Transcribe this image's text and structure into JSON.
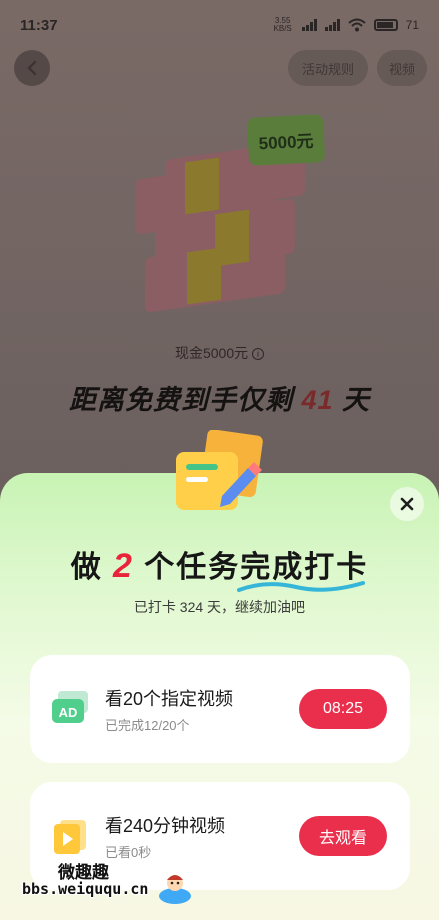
{
  "status_bar": {
    "time": "11:37",
    "net_speed": "3.55\nKB/S",
    "battery_percent": "71"
  },
  "header": {
    "back_icon": "chevron-left-icon",
    "pill_rules": "活动规则",
    "pill_video": "视频"
  },
  "reward": {
    "price_tag": "5000元",
    "cash_label": "现金5000元",
    "countdown_prefix": "距离免费到手仅剩",
    "countdown_days": "41",
    "countdown_suffix": "天"
  },
  "sheet": {
    "title_prefix": "做",
    "title_count": "2",
    "title_middle": "个任务",
    "title_emph": "完成打卡",
    "subtitle": "已打卡 324 天，继续加油吧",
    "close_icon": "close-icon"
  },
  "tasks": [
    {
      "icon": "ad-icon",
      "icon_text": "AD",
      "title": "看20个指定视频",
      "subtitle": "已完成12/20个",
      "button": "08:25"
    },
    {
      "icon": "video-play-icon",
      "title": "看240分钟视频",
      "subtitle": "已看0秒",
      "button": "去观看"
    }
  ],
  "watermark": {
    "cn": "微趣趣",
    "url": "bbs.weiququ.cn"
  },
  "colors": {
    "accent_red": "#ea2f4d",
    "sheet_green": "#c8f3b4",
    "card_white": "#ffffff"
  }
}
